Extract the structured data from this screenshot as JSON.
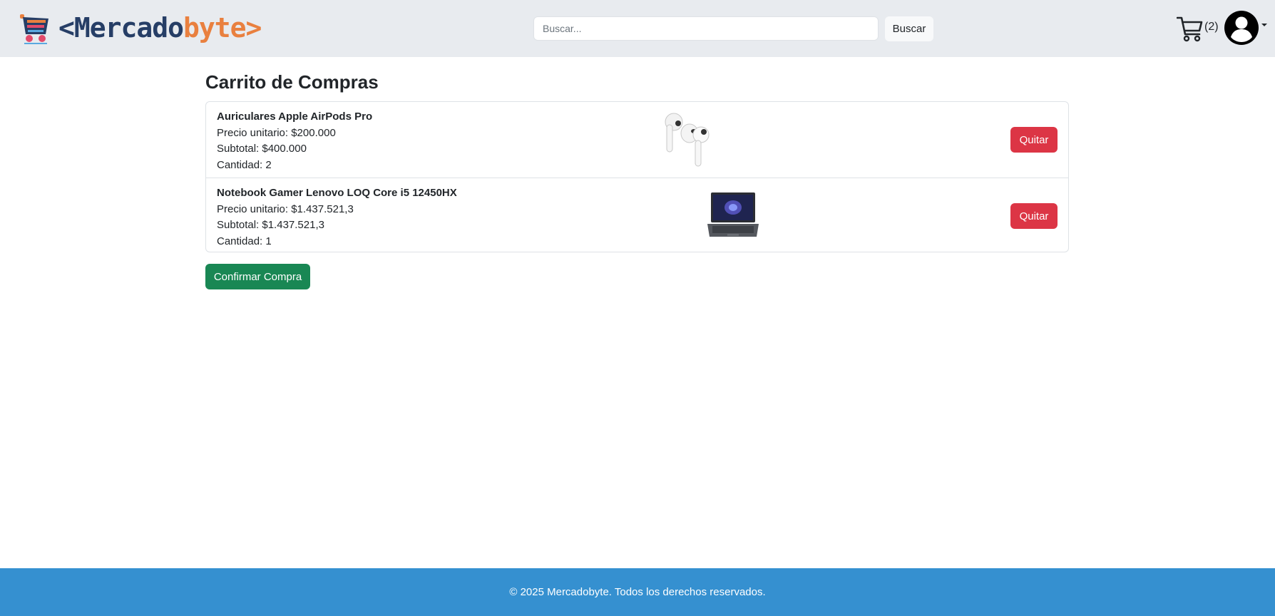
{
  "brand": {
    "prefix": "<Mercado",
    "suffix": "byte>"
  },
  "search": {
    "placeholder": "Buscar...",
    "button_label": "Buscar"
  },
  "cart": {
    "count_text": "(2)"
  },
  "page": {
    "title": "Carrito de Compras"
  },
  "items": [
    {
      "name": "Auriculares Apple AirPods Pro",
      "unit_price": "Precio unitario: $200.000",
      "subtotal": "Subtotal: $400.000",
      "quantity": "Cantidad: 2",
      "remove_label": "Quitar"
    },
    {
      "name": "Notebook Gamer Lenovo LOQ Core i5 12450HX",
      "unit_price": "Precio unitario: $1.437.521,3",
      "subtotal": "Subtotal: $1.437.521,3",
      "quantity": "Cantidad: 1",
      "remove_label": "Quitar"
    }
  ],
  "actions": {
    "confirm_label": "Confirmar Compra"
  },
  "footer": {
    "text": "© 2025 Mercadobyte. Todos los derechos reservados."
  },
  "colors": {
    "navbar_bg": "#e8ebef",
    "brand_dark": "#263e66",
    "brand_orange": "#e9803f",
    "danger": "#dc3545",
    "success": "#198754",
    "footer_bg": "#3590d0"
  }
}
